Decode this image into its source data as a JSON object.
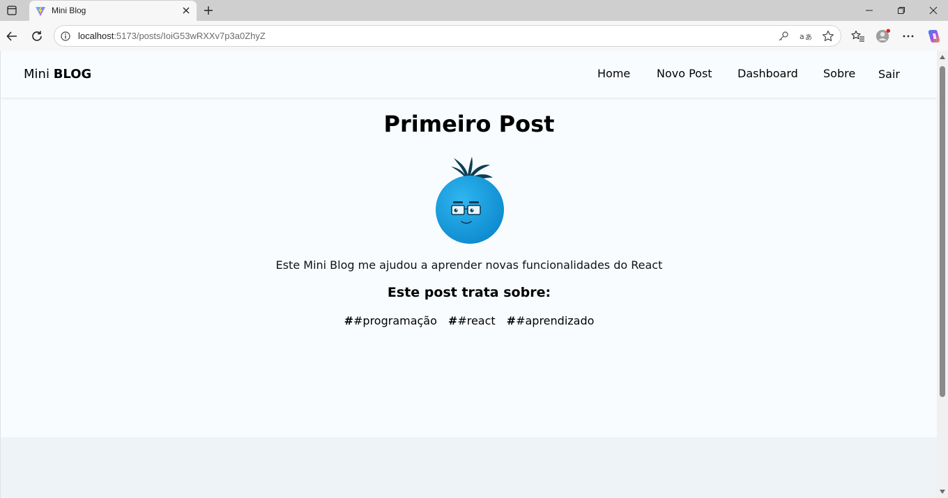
{
  "browser": {
    "tab": {
      "title": "Mini Blog",
      "favicon": "vite-logo-icon"
    },
    "address_bar": {
      "url_host": "localhost",
      "url_rest": ":5173/posts/IoiG53wRXXv7p3a0ZhyZ"
    },
    "icons": [
      "tab-actions-icon",
      "close-tab-icon",
      "new-tab-icon",
      "minimize-icon",
      "restore-icon",
      "close-window-icon",
      "back-icon",
      "reload-icon",
      "site-info-icon",
      "password-key-icon",
      "translate-icon",
      "favorite-star-icon",
      "favorites-icon",
      "profile-avatar-icon",
      "more-menu-icon",
      "copilot-icon"
    ]
  },
  "navbar": {
    "brand_light": "Mini",
    "brand_bold": "BLOG",
    "links": [
      {
        "label": "Home"
      },
      {
        "label": "Novo Post"
      },
      {
        "label": "Dashboard"
      },
      {
        "label": "Sobre"
      }
    ],
    "exit_label": "Sair"
  },
  "post": {
    "title": "Primeiro Post",
    "image_icon": "mascot-avatar-icon",
    "body": "Este Mini Blog me ajudou a aprender novas funcionalidades do React",
    "tags_heading": "Este post trata sobre:",
    "tag_prefix": "#",
    "tags": [
      "#programação",
      "#react",
      "#aprendizado"
    ]
  },
  "colors": {
    "page_background": "#f8fcff",
    "footer_background": "#edf3f6",
    "mascot_blue": "#1196d8",
    "mascot_hair": "#0d3e57"
  }
}
